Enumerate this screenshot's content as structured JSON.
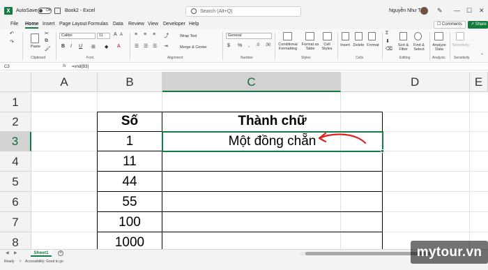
{
  "window": {
    "autosave_label": "AutoSave",
    "autosave_state": "Off",
    "doc_title": "Book2 - Excel",
    "search_placeholder": "Search (Alt+Q)",
    "user_name": "Nguyễn Như Tài"
  },
  "menu": {
    "items": [
      "File",
      "Home",
      "Insert",
      "Page Layout",
      "Formulas",
      "Data",
      "Review",
      "View",
      "Developer",
      "Help"
    ],
    "active": "Home",
    "comments_label": "Comments",
    "share_label": "Share"
  },
  "ribbon": {
    "clipboard": {
      "paste_label": "Paste",
      "group_label": "Clipboard"
    },
    "font": {
      "font_name": "Calibri",
      "font_size": "11",
      "group_label": "Font",
      "bold": "B",
      "italic": "I",
      "underline": "U"
    },
    "alignment": {
      "wrap_text": "Wrap Text",
      "merge_center": "Merge & Center",
      "group_label": "Alignment"
    },
    "number": {
      "format": "General",
      "group_label": "Number"
    },
    "styles": {
      "conditional_formatting": "Conditional Formatting",
      "format_as_table": "Format as Table",
      "cell_styles": "Cell Styles",
      "group_label": "Styles"
    },
    "cells": {
      "insert": "Insert",
      "delete": "Delete",
      "format": "Format",
      "group_label": "Cells"
    },
    "editing": {
      "sort_filter": "Sort & Filter",
      "find_select": "Find & Select",
      "group_label": "Editing"
    },
    "analysis": {
      "analyze_data": "Analyze Data",
      "group_label": "Analysis"
    },
    "sensitivity": {
      "label": "Sensitivity",
      "group_label": "Sensitivity"
    }
  },
  "formula_bar": {
    "name_box": "C3",
    "fx": "fx",
    "formula": "=vnd(B3)"
  },
  "grid": {
    "columns": [
      "A",
      "B",
      "C",
      "D",
      "E"
    ],
    "selected_column": "C",
    "rows": [
      "1",
      "2",
      "3",
      "4",
      "5",
      "6",
      "7",
      "8"
    ],
    "selected_row": "3",
    "header_b": "Số",
    "header_c": "Thành chữ",
    "values_b": [
      "1",
      "11",
      "44",
      "55",
      "100",
      "1000"
    ],
    "value_c3": "Một đồng chẵn"
  },
  "sheets": {
    "tabs": [
      "Sheet1"
    ],
    "active": "Sheet1"
  },
  "status": {
    "ready": "Ready",
    "accessibility": "Accessibility: Good to go"
  },
  "watermark": "mytour.vn",
  "colors": {
    "accent": "#107c41",
    "arrow": "#e02020"
  }
}
